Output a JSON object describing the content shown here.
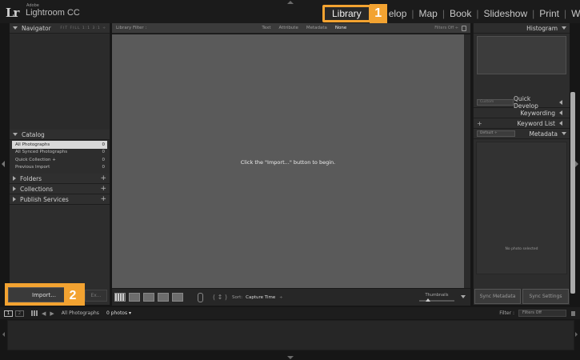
{
  "app": {
    "adobe": "Adobe",
    "product": "Lightroom CC",
    "logo": "Lr"
  },
  "modules": {
    "library": "Library",
    "develop_partial": "elop",
    "map": "Map",
    "book": "Book",
    "slideshow": "Slideshow",
    "print": "Print",
    "web_partial": "Web",
    "separator": "|"
  },
  "callouts": {
    "step1": "1",
    "step2": "2",
    "accent_color": "#f3a331"
  },
  "left_panel": {
    "navigator": {
      "title": "Navigator",
      "options": "FIT FILL 1:1 3:1 ÷"
    },
    "catalog": {
      "title": "Catalog",
      "items": [
        {
          "label": "All Photographs",
          "count": "0"
        },
        {
          "label": "All Synced Photographs",
          "count": "0"
        },
        {
          "label": "Quick Collection +",
          "count": "0"
        },
        {
          "label": "Previous Import",
          "count": "0"
        }
      ]
    },
    "folders": {
      "title": "Folders",
      "plus": "+"
    },
    "collections": {
      "title": "Collections",
      "plus": "+"
    },
    "publish": {
      "title": "Publish Services",
      "plus": "+"
    },
    "import_label": "Import...",
    "export_label": "Ex..."
  },
  "center": {
    "filter_bar": {
      "title": "Library Filter :",
      "tabs": [
        "Text",
        "Attribute",
        "Metadata",
        "None"
      ],
      "filters_off": "Filters Off ÷"
    },
    "message": "Click the \"Import...\" button to begin.",
    "toolbar": {
      "sort_label": "Sort:",
      "sort_value": "Capture Time",
      "sort_chevron": "÷",
      "sort_arrows": "( ↕ )",
      "thumbnails_label": "Thumbnails"
    }
  },
  "right_panel": {
    "histogram": "Histogram",
    "saved_preset": "Custom",
    "quick_develop": "Quick Develop",
    "keywording": "Keywording",
    "keyword_list": "Keyword List",
    "keyword_plus": "+",
    "metadata": "Metadata",
    "metadata_preset": "Default ÷",
    "no_photo": "No photo selected",
    "sync_metadata": "Sync Metadata",
    "sync_settings": "Sync Settings"
  },
  "filmstrip": {
    "monitor1": "1",
    "monitor2": "2",
    "source": "All Photographs",
    "count": "0 photos ▾",
    "filter_label": "Filter :",
    "filter_value": "Filters Off"
  }
}
